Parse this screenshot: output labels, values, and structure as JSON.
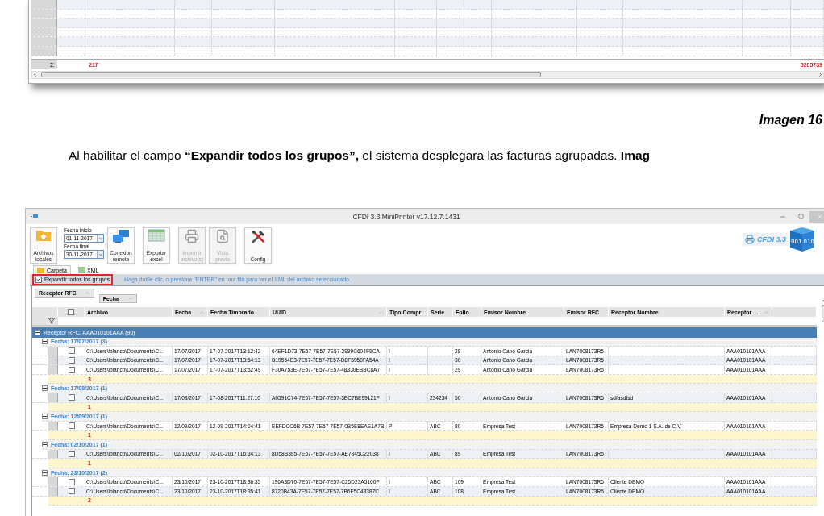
{
  "previous_screenshot": {
    "grid": {
      "summary": {
        "symbol": "Σ",
        "count": "217",
        "total": "5205739"
      }
    }
  },
  "caption": "Imagen 16",
  "paragraph": "Al habilitar el campo **“Expandir todos los grupos”,** el sistema  desplegara las facturas agrupadas. **Imag**",
  "window": {
    "title": "CFDI 3.3 MiniPrinter v17.12.7.1431",
    "toolbar": [
      {
        "kind": "local",
        "label": "Archivos locales",
        "disabled": false
      },
      {
        "kind": "dates",
        "fields": [
          {
            "label": "Fecha inicio",
            "value": "01-11-2017"
          },
          {
            "label": "Fecha final",
            "value": "30-11-2017"
          }
        ]
      },
      {
        "kind": "remote",
        "label": "Conexion remota",
        "disabled": false
      },
      {
        "kind": "excel",
        "label": "Exportar excel",
        "disabled": false
      },
      {
        "kind": "print",
        "label": "Imprimir archivo(s)",
        "disabled": true
      },
      {
        "kind": "preview",
        "label": "Vista previa",
        "disabled": true
      },
      {
        "kind": "config",
        "label": "Config",
        "disabled": false
      }
    ],
    "logo": {
      "text": "CFDI 3.3",
      "cube_text": "001 010"
    },
    "tabs": [
      {
        "label": "Carpeta",
        "selected": true
      },
      {
        "label": "XML",
        "selected": false
      }
    ],
    "expand_all": {
      "label": "Expandir todos los grupos",
      "checked": true,
      "highlighted": true
    },
    "hint": "Haga doble clic, o presione \"ENTER\" en una fila para ver el XML del archivo seleccionado",
    "select_all": {
      "checked": false
    },
    "group_panel": [
      {
        "label": "Receptor RFC"
      },
      {
        "label": "Fecha"
      }
    ],
    "columns": [
      {
        "label": "Archivo",
        "sorted": false
      },
      {
        "label": "Fecha",
        "sorted": true
      },
      {
        "label": "Fecha Timbrado",
        "sorted": false
      },
      {
        "label": "UUID",
        "sorted": true
      },
      {
        "label": "Tipo Compr",
        "sorted": false
      },
      {
        "label": "Serie",
        "sorted": false
      },
      {
        "label": "Folio",
        "sorted": false
      },
      {
        "label": "Emisor Nombre",
        "sorted": false
      },
      {
        "label": "Emisor RFC",
        "sorted": false
      },
      {
        "label": "Receptor Nombre",
        "sorted": false
      },
      {
        "label": "Receptor ...",
        "sorted": true
      }
    ],
    "group": {
      "label": "Receptor RFC:  AAA010101AAA (90)",
      "expanded": true,
      "children": [
        {
          "label": "Fecha:  17/07/2017 (3)",
          "expanded": true,
          "count": "3",
          "rows": [
            {
              "checked": false,
              "archivo": "C:\\Users\\lblanco\\Documents\\C...",
              "fecha": "17/07/2017",
              "fecha_timbrado": "17-07-2017T13:12:42",
              "uuid": "64EF1D73-7E57-7E57-7E57-2989C604F9CA",
              "tipo_compr": "I",
              "folio": "28",
              "emisor_nombre": "Antonio Cano Garcia",
              "emisor_rfc": "LAN7008173R5",
              "receptor_rfc": "AAA010101AAA"
            },
            {
              "checked": false,
              "archivo": "C:\\Users\\lblanco\\Documents\\C...",
              "fecha": "17/07/2017",
              "fecha_timbrado": "17-07-2017T13:54:13",
              "uuid": "B19554E3-7E57-7E57-7E57-D8F5950FA54A",
              "tipo_compr": "I",
              "folio": "30",
              "emisor_nombre": "Antonio Cano Garcia",
              "emisor_rfc": "LAN7008173R5",
              "receptor_rfc": "AAA010101AAA"
            },
            {
              "checked": false,
              "archivo": "C:\\Users\\lblanco\\Documents\\C...",
              "fecha": "17/07/2017",
              "fecha_timbrado": "17-07-2017T13:52:49",
              "uuid": "F30A753E-7E57-7E57-7E57-48330EBBC8A7",
              "tipo_compr": "I",
              "folio": "29",
              "emisor_nombre": "Antonio Cano Garcia",
              "emisor_rfc": "LAN7008173R5",
              "receptor_rfc": "AAA010101AAA"
            }
          ]
        },
        {
          "label": "Fecha:  17/08/2017 (1)",
          "expanded": true,
          "count": "1",
          "rows": [
            {
              "checked": false,
              "archivo": "C:\\Users\\lblanco\\Documents\\C...",
              "fecha": "17/08/2017",
              "fecha_timbrado": "17-08-2017T11:27:10",
              "uuid": "A0591C74-7E57-7E57-7E57-3EC7BE99121F",
              "tipo_compr": "I",
              "serie": "234234",
              "folio": "50",
              "emisor_nombre": "Antonio Cano Garcia",
              "emisor_rfc": "LAN7008173R5",
              "receptor_nombre": "sdfasdfsd",
              "receptor_rfc": "AAA010101AAA"
            }
          ]
        },
        {
          "label": "Fecha:  12/09/2017 (1)",
          "expanded": true,
          "count": "1",
          "rows": [
            {
              "checked": false,
              "archivo": "C:\\Users\\lblanco\\Documents\\C...",
              "fecha": "12/09/2017",
              "fecha_timbrado": "12-09-2017T14:04:41",
              "uuid": "EEFDCC6B-7E57-7E57-7E57-0B5E8EAE1A7B",
              "tipo_compr": "P",
              "serie": "ABC",
              "folio": "80",
              "emisor_nombre": "Empresa Test",
              "emisor_rfc": "LAN7008173R5",
              "receptor_nombre": "Empresa Demo 1 S.A. de C.V.",
              "receptor_rfc": "AAA010101AAA"
            }
          ]
        },
        {
          "label": "Fecha:  02/10/2017 (1)",
          "expanded": true,
          "count": "1",
          "rows": [
            {
              "checked": false,
              "archivo": "C:\\Users\\lblanco\\Documents\\C...",
              "fecha": "02/10/2017",
              "fecha_timbrado": "02-10-2017T16:34:13",
              "uuid": "8D58B395-7E57-7E57-7E57-AE7845C22038",
              "tipo_compr": "I",
              "serie": "ABC",
              "folio": "89",
              "emisor_nombre": "Empresa Test",
              "emisor_rfc": "LAN7008173R5",
              "receptor_rfc": "AAA010101AAA"
            }
          ]
        },
        {
          "label": "Fecha:  23/10/2017 (2)",
          "expanded": true,
          "count": "2",
          "rows": [
            {
              "checked": false,
              "archivo": "C:\\Users\\lblanco\\Documents\\C...",
              "fecha": "23/10/2017",
              "fecha_timbrado": "23-10-2017T18:36:35",
              "uuid": "196A3D70-7E57-7E57-7E57-C25D23A5160F",
              "tipo_compr": "I",
              "serie": "ABC",
              "folio": "109",
              "emisor_nombre": "Empresa Test",
              "emisor_rfc": "LAN7008173R5",
              "receptor_nombre": "Cliente DEMO",
              "receptor_rfc": "AAA010101AAA"
            },
            {
              "checked": false,
              "archivo": "C:\\Users\\lblanco\\Documents\\C...",
              "fecha": "23/10/2017",
              "fecha_timbrado": "23-10-2017T18:35:41",
              "uuid": "8720B43A-7E57-7E57-7E57-7B6F5C48387C",
              "tipo_compr": "I",
              "serie": "ABC",
              "folio": "108",
              "emisor_nombre": "Empresa Test",
              "emisor_rfc": "LAN7008173R5",
              "receptor_nombre": "Cliente DEMO",
              "receptor_rfc": "AAA010101AAA"
            }
          ]
        }
      ]
    }
  }
}
